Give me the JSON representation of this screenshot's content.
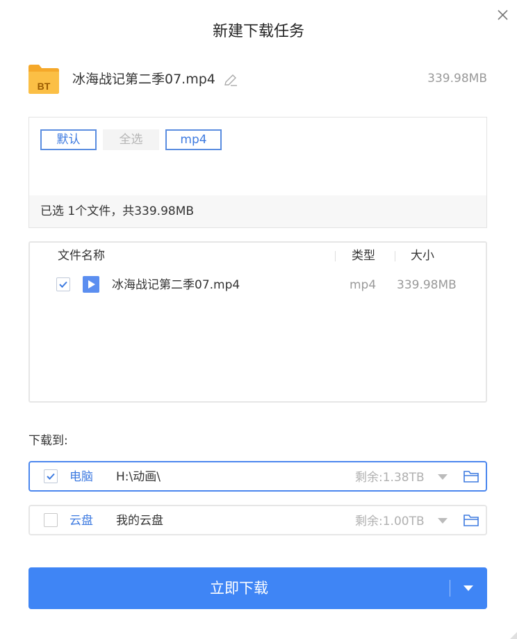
{
  "dialog": {
    "title": "新建下载任务"
  },
  "torrent": {
    "name": "冰海战记第二季07.mp4",
    "size": "339.98MB",
    "icon_label": "BT"
  },
  "filters": {
    "buttons": [
      {
        "label": "默认",
        "state": "active"
      },
      {
        "label": "全选",
        "state": "inactive"
      },
      {
        "label": "mp4",
        "state": "active"
      }
    ],
    "summary": "已选 1个文件，共339.98MB"
  },
  "file_list": {
    "columns": {
      "name": "文件名称",
      "type": "类型",
      "size": "大小"
    },
    "rows": [
      {
        "checked": true,
        "name": "冰海战记第二季07.mp4",
        "type": "mp4",
        "size": "339.98MB",
        "icon": "video-play-icon"
      }
    ]
  },
  "download_to": {
    "label": "下载到:",
    "destinations": [
      {
        "checked": true,
        "name": "电脑",
        "path": "H:\\动画\\",
        "free": "剩余:1.38TB"
      },
      {
        "checked": false,
        "name": "云盘",
        "path": "我的云盘",
        "free": "剩余:1.00TB"
      }
    ]
  },
  "actions": {
    "primary_label": "立即下载"
  },
  "colors": {
    "accent": "#3f85f5",
    "link_blue": "#3d7ae0",
    "folder_orange": "#f7b23b",
    "muted_text": "#999999"
  }
}
